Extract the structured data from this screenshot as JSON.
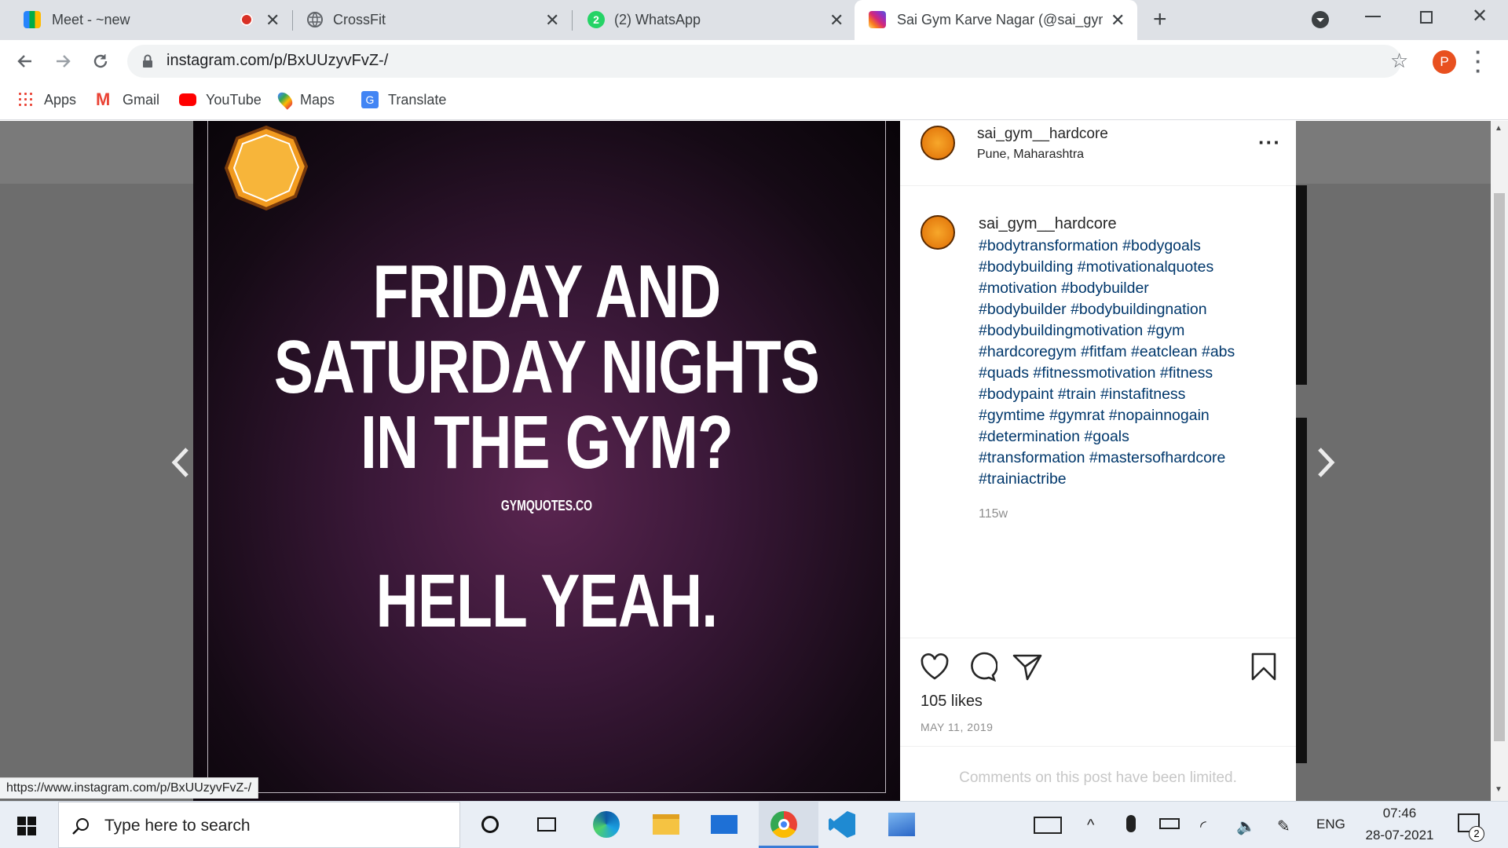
{
  "browser": {
    "tabs": [
      {
        "title": "Meet - ~new",
        "icon": "google-meet-icon",
        "recording": true
      },
      {
        "title": "CrossFit",
        "icon": "globe-icon"
      },
      {
        "title": "(2) WhatsApp",
        "icon": "whatsapp-icon",
        "badge": "2"
      },
      {
        "title": "Sai Gym Karve Nagar (@sai_gym",
        "icon": "instagram-icon",
        "active": true
      }
    ],
    "address": "instagram.com/p/BxUUzyvFvZ-/",
    "profile_initial": "P",
    "bookmarks": [
      {
        "label": "Apps",
        "icon": "apps-grid-icon"
      },
      {
        "label": "Gmail",
        "icon": "gmail-icon"
      },
      {
        "label": "YouTube",
        "icon": "youtube-icon"
      },
      {
        "label": "Maps",
        "icon": "maps-icon"
      },
      {
        "label": "Translate",
        "icon": "translate-icon"
      }
    ],
    "status_url": "https://www.instagram.com/p/BxUUzyvFvZ-/"
  },
  "post": {
    "image_text": {
      "line1": "FRIDAY AND",
      "line2": "SATURDAY NIGHTS",
      "line3": "IN THE GYM?",
      "source": "GYMQUOTES.CO",
      "line4": "HELL YEAH."
    },
    "username": "sai_gym__hardcore",
    "location": "Pune, Maharashtra",
    "caption_username": "sai_gym__hardcore",
    "caption_lines": [
      "#bodytransformation #bodygoals",
      "#bodybuilding #motivationalquotes",
      "#motivation #bodybuilder",
      "#bodybuilder #bodybuildingnation",
      "#bodybuildingmotivation #gym",
      "#hardcoregym #fitfam #eatclean #abs",
      "#quads #fitnessmotivation #fitness",
      "#bodypaint #train #instafitness",
      "#gymtime #gymrat #nopainnogain",
      "#determination #goals",
      "#transformation #mastersofhardcore",
      "#trainiactribe"
    ],
    "age": "115w",
    "likes": "105 likes",
    "date": "MAY 11, 2019",
    "comments_note": "Comments on this post have been limited."
  },
  "taskbar": {
    "search_placeholder": "Type here to search",
    "language": "ENG",
    "time": "07:46",
    "date": "28-07-2021",
    "notification_count": "2"
  },
  "colors": {
    "instagram_link": "#00376b",
    "chrome_tabstrip": "#dee1e6",
    "profile_avatar": "#e8501f",
    "overlay": "#6d6d6d"
  }
}
